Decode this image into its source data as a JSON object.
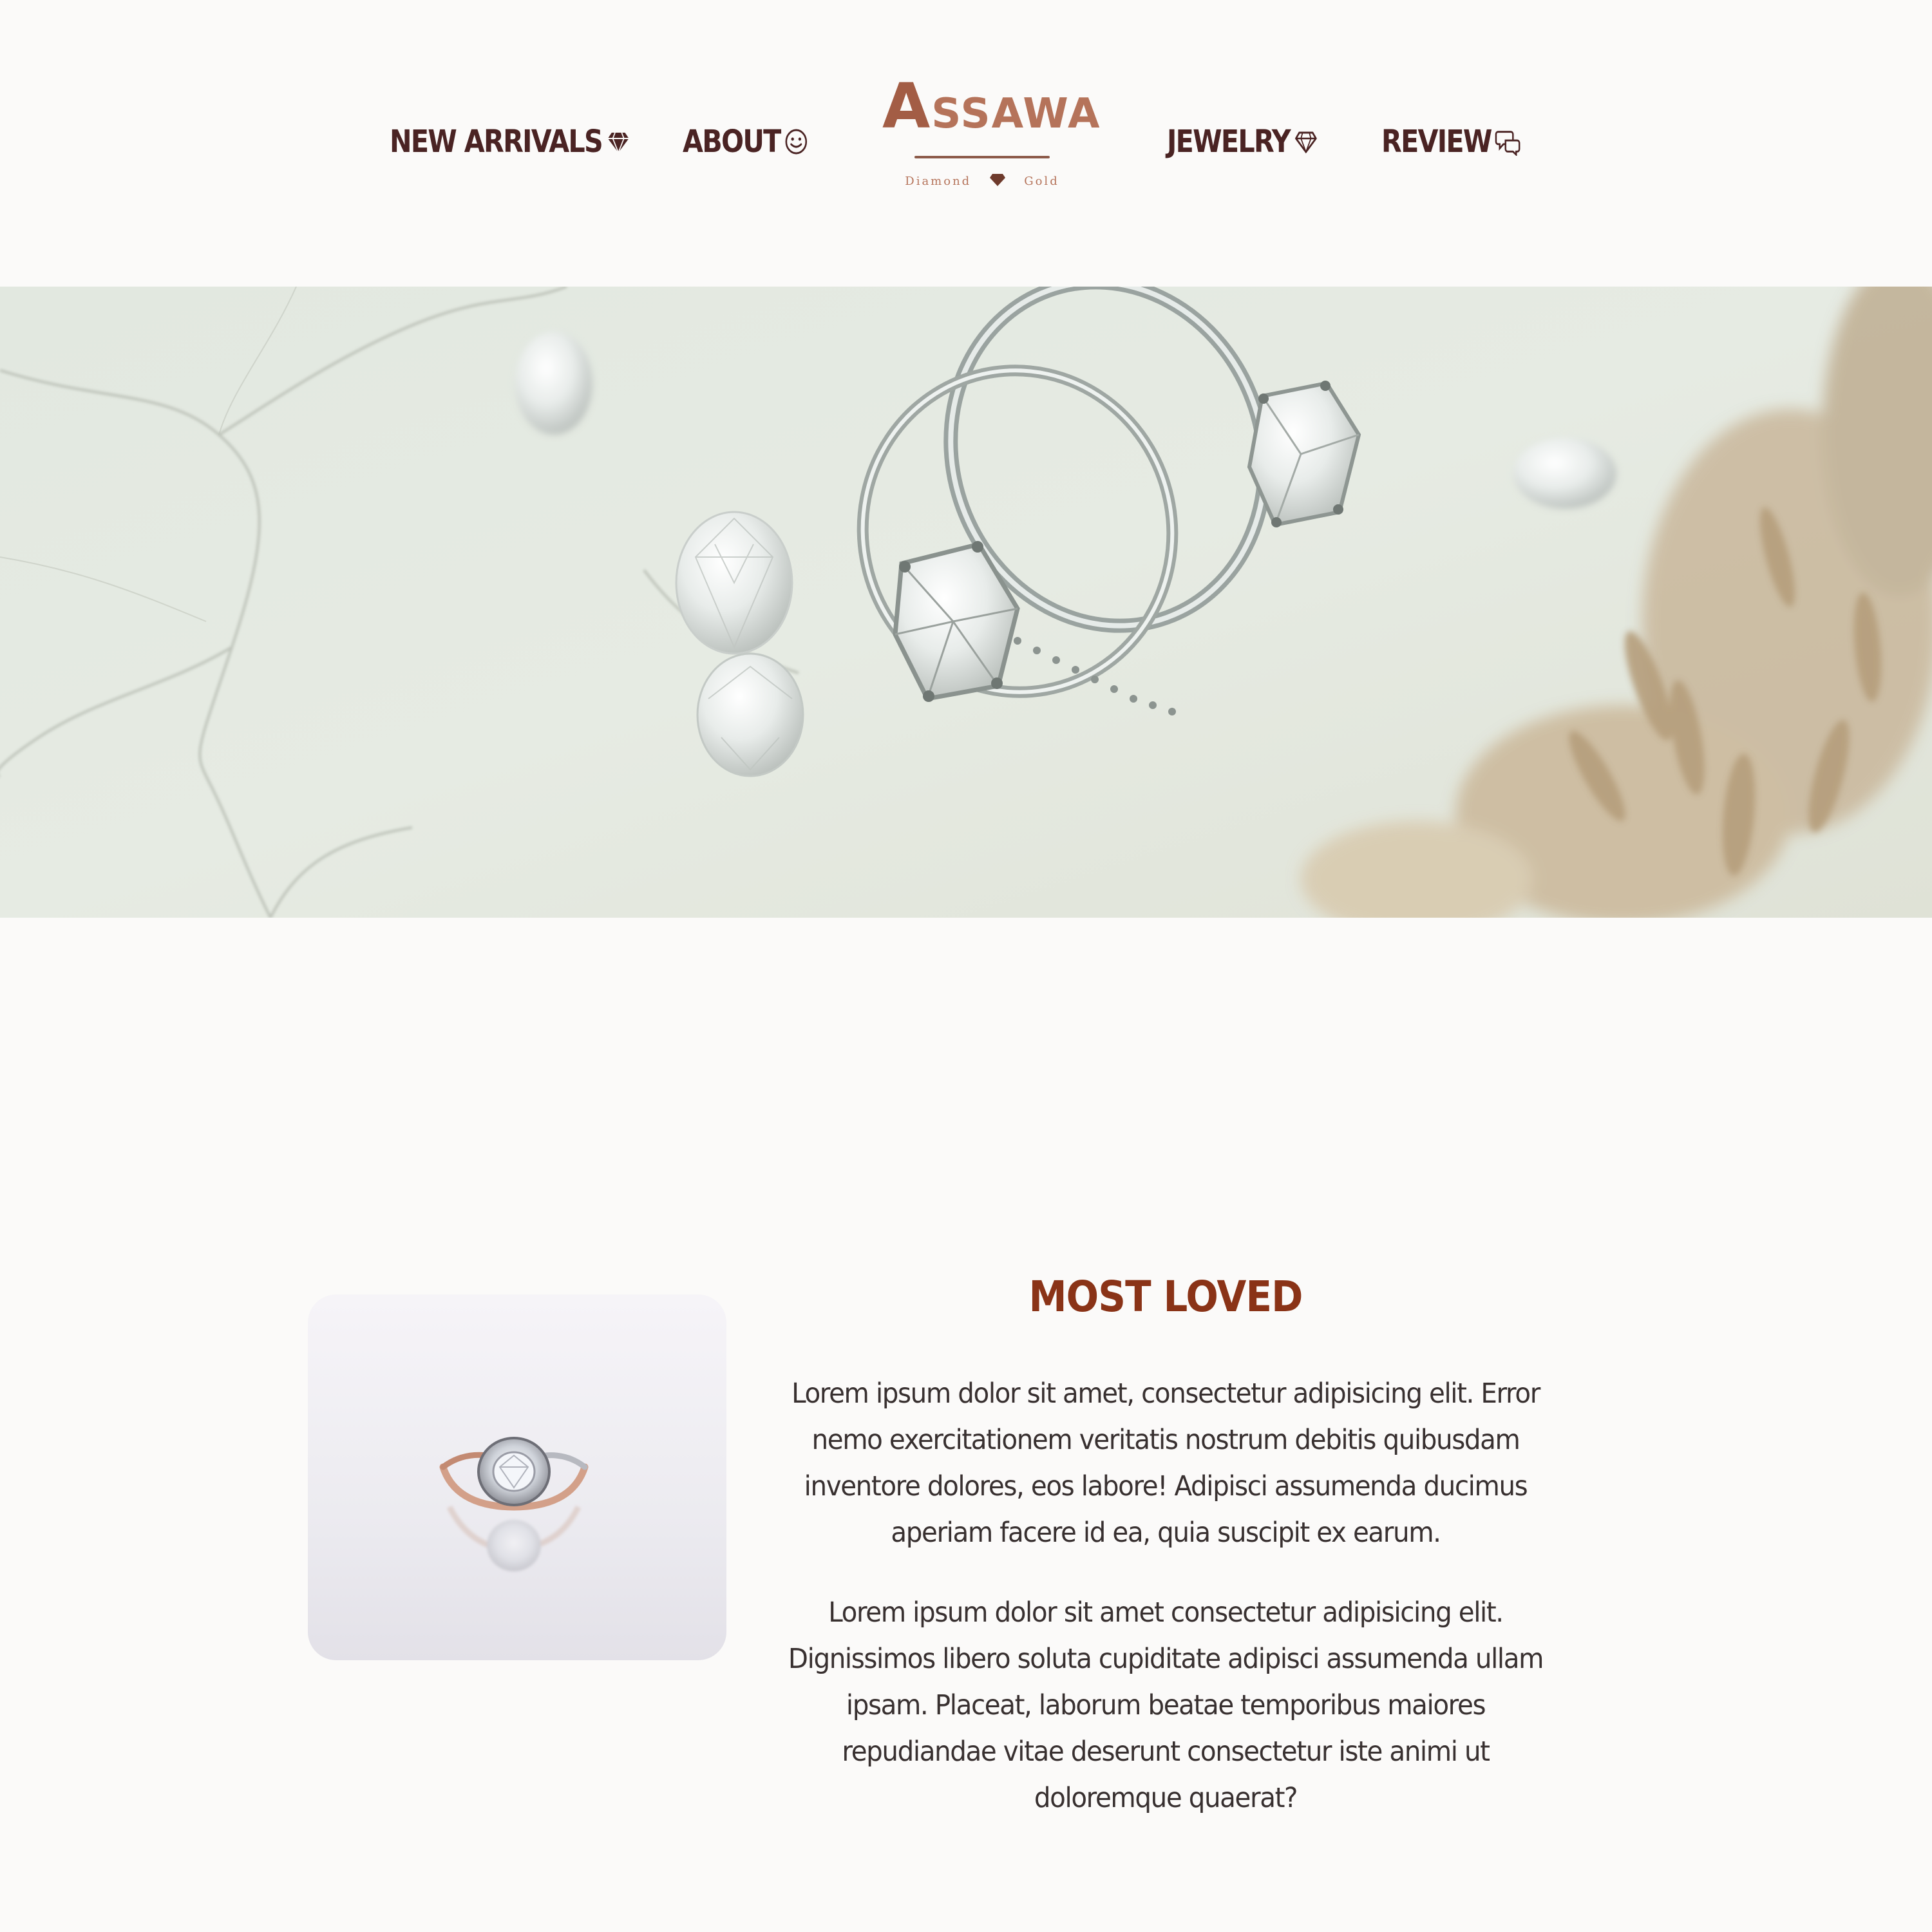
{
  "nav": {
    "items": [
      {
        "label": "NEW ARRIVALS",
        "icon": "diamond-icon"
      },
      {
        "label": "ABOUT",
        "icon": "smiley-icon"
      },
      {
        "label": "JEWELRY",
        "icon": "diamond-outline-icon"
      },
      {
        "label": "REVIEW",
        "icon": "chat-bubbles-icon"
      }
    ]
  },
  "brand": {
    "logo_word_first": "A",
    "logo_word_rest": "SSAWA",
    "tagline_left": "Diamond",
    "tagline_right": "Gold"
  },
  "hero": {
    "image": "hero-rings-on-marble"
  },
  "most_loved": {
    "title": "MOST LOVED",
    "product_image": "halo-diamond-ring",
    "paragraphs": [
      "Lorem ipsum dolor sit amet, consectetur adipisicing elit. Error nemo exercitationem veritatis nostrum debitis quibusdam inventore dolores, eos labore! Adipisci assumenda ducimus aperiam facere id ea, quia suscipit ex earum.",
      "Lorem ipsum dolor sit amet consectetur adipisicing elit. Dignissimos libero soluta cupiditate adipisci assumenda ullam ipsam. Placeat, laborum beatae temporibus maiores repudiandae vitae deserunt consectetur iste animi ut doloremque quaerat?"
    ]
  },
  "colors": {
    "background": "#fbfaf9",
    "nav_text": "#4a2323",
    "brand_copper": "#b5735a",
    "title": "#8a3317",
    "body_text": "#383030"
  }
}
